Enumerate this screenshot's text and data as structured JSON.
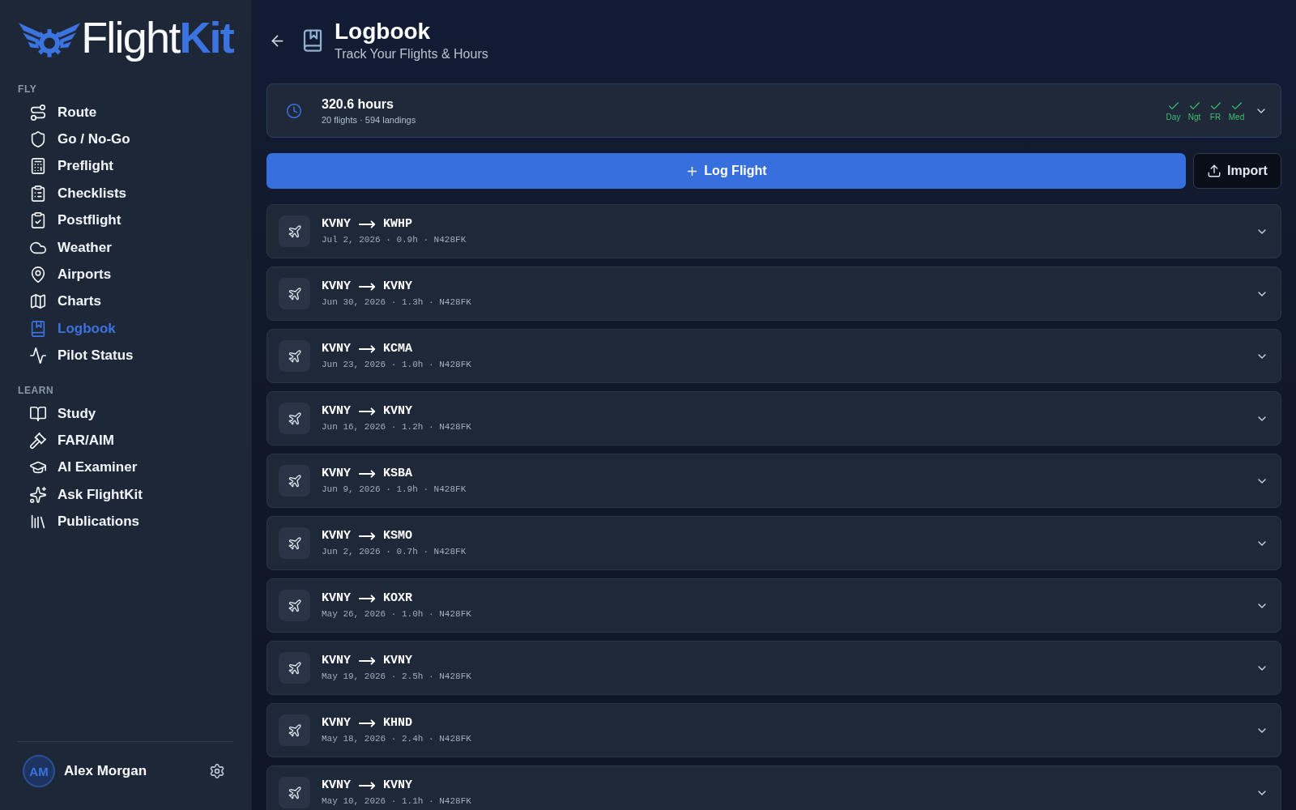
{
  "brand": {
    "name": "Flight",
    "accent": "Kit"
  },
  "sidebar": {
    "sections": [
      {
        "label": "FLY",
        "items": [
          {
            "label": "Route",
            "selected": false
          },
          {
            "label": "Go / No-Go",
            "selected": false
          },
          {
            "label": "Preflight",
            "selected": false
          },
          {
            "label": "Checklists",
            "selected": false
          },
          {
            "label": "Postflight",
            "selected": false
          },
          {
            "label": "Weather",
            "selected": false
          },
          {
            "label": "Airports",
            "selected": false
          },
          {
            "label": "Charts",
            "selected": false
          },
          {
            "label": "Logbook",
            "selected": true
          },
          {
            "label": "Pilot Status",
            "selected": false
          }
        ]
      },
      {
        "label": "LEARN",
        "items": [
          {
            "label": "Study",
            "selected": false
          },
          {
            "label": "FAR/AIM",
            "selected": false
          },
          {
            "label": "AI Examiner",
            "selected": false
          },
          {
            "label": "Ask FlightKit",
            "selected": false
          },
          {
            "label": "Publications",
            "selected": false
          }
        ]
      }
    ]
  },
  "user": {
    "initials": "AM",
    "name": "Alex Morgan"
  },
  "header": {
    "title": "Logbook",
    "subtitle": "Track Your Flights & Hours"
  },
  "summary": {
    "total": "320.6 hours",
    "detail": "20 flights · 594 landings",
    "expanded": false,
    "currency": [
      {
        "label": "Day",
        "checked": true
      },
      {
        "label": "Ngt",
        "checked": true
      },
      {
        "label": "FR",
        "checked": true
      },
      {
        "label": "Med",
        "checked": true
      }
    ]
  },
  "actions": {
    "primary": "Log Flight",
    "secondary": "Import"
  },
  "flights": [
    {
      "from": "KVNY",
      "to": "KWHP",
      "detail": "Jul 2, 2026 · 0.9h · N428FK",
      "expanded": false
    },
    {
      "from": "KVNY",
      "to": "KVNY",
      "detail": "Jun 30, 2026 · 1.3h · N428FK",
      "expanded": false
    },
    {
      "from": "KVNY",
      "to": "KCMA",
      "detail": "Jun 23, 2026 · 1.0h · N428FK",
      "expanded": false
    },
    {
      "from": "KVNY",
      "to": "KVNY",
      "detail": "Jun 16, 2026 · 1.2h · N428FK",
      "expanded": false
    },
    {
      "from": "KVNY",
      "to": "KSBA",
      "detail": "Jun 9, 2026 · 1.9h · N428FK",
      "expanded": false
    },
    {
      "from": "KVNY",
      "to": "KSMO",
      "detail": "Jun 2, 2026 · 0.7h · N428FK",
      "expanded": false
    },
    {
      "from": "KVNY",
      "to": "KOXR",
      "detail": "May 26, 2026 · 1.0h · N428FK",
      "expanded": false
    },
    {
      "from": "KVNY",
      "to": "KVNY",
      "detail": "May 19, 2026 · 2.5h · N428FK",
      "expanded": false
    },
    {
      "from": "KVNY",
      "to": "KHND",
      "detail": "May 18, 2026 · 2.4h · N428FK",
      "expanded": false
    },
    {
      "from": "KVNY",
      "to": "KVNY",
      "detail": "May 10, 2026 · 1.1h · N428FK",
      "expanded": false
    }
  ]
}
